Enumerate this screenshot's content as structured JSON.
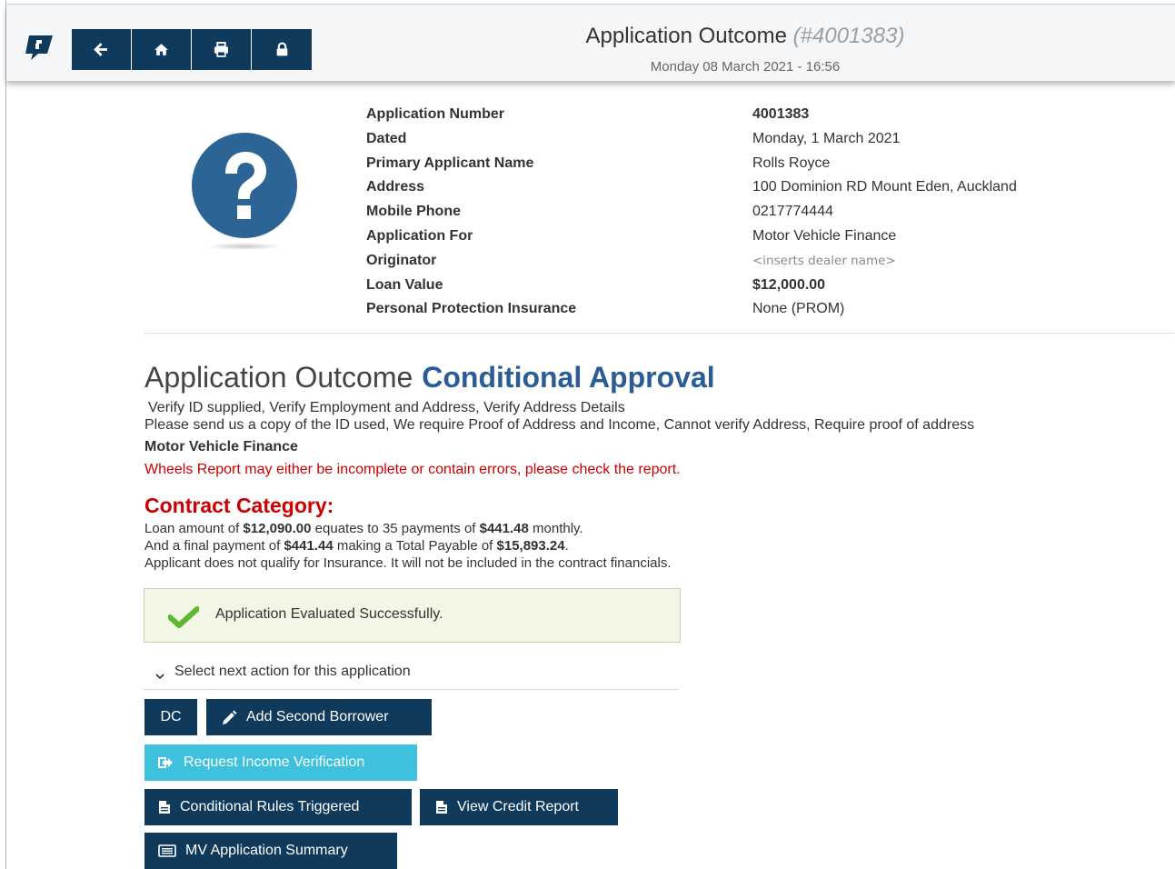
{
  "header": {
    "title": "Application Outcome",
    "app_number_display": "(#4001383)",
    "datetime": "Monday 08 March 2021 - 16:56",
    "nav_icons": [
      "back-arrow-icon",
      "home-icon",
      "print-icon",
      "lock-icon"
    ]
  },
  "applicant": {
    "labels": {
      "application_number": "Application Number",
      "dated": "Dated",
      "primary_applicant_name": "Primary Applicant Name",
      "address": "Address",
      "mobile_phone": "Mobile Phone",
      "application_for": "Application For",
      "originator": "Originator",
      "loan_value": "Loan Value",
      "ppi": "Personal Protection Insurance"
    },
    "values": {
      "application_number": "4001383",
      "dated": "Monday, 1 March 2021",
      "primary_applicant_name": "Rolls Royce",
      "address": "100 Dominion RD Mount Eden, Auckland",
      "mobile_phone": "0217774444",
      "application_for": "Motor Vehicle Finance",
      "originator": "<inserts dealer name>",
      "loan_value": "$12,000.00",
      "ppi": "None (PROM)"
    }
  },
  "outcome": {
    "title": "Application Outcome",
    "status": "Conditional Approval",
    "verify_requirements": "Verify ID supplied, Verify Employment and Address, Verify Address Details",
    "requests": "Please send us a copy of the ID used, We require Proof of Address and Income, Cannot verify Address, Require proof of address",
    "product": "Motor Vehicle Finance",
    "warning": "Wheels Report may either be incomplete or contain errors, please check the report."
  },
  "contract": {
    "title": "Contract Category:",
    "line1_pre": "Loan amount of ",
    "loan_amount": "$12,090.00",
    "line1_mid": " equates to 35 payments of ",
    "payment_amount": "$441.48",
    "line1_post": " monthly.",
    "line2_pre": "And a final payment of ",
    "final_payment": "$441.44",
    "line2_mid": " making a Total Payable of ",
    "total_payable": "$15,893.24",
    "line2_post": ".",
    "insurance_note": "Applicant does not qualify for Insurance. It will not be included in the contract financials."
  },
  "alert": {
    "message": "Application Evaluated Successfully.",
    "color": "#5cb82e"
  },
  "actions": {
    "section_label": "Select next action for this application",
    "dc": "DC",
    "add_second_borrower": "Add Second Borrower",
    "request_income_verification": "Request Income Verification",
    "conditional_rules_triggered": "Conditional Rules Triggered",
    "view_credit_report": "View Credit Report",
    "mv_application_summary": "MV Application Summary"
  },
  "colors": {
    "primary": "#0f3a5c",
    "accent": "#3fc0dc",
    "status_approval": "#2a5c96",
    "warning": "#cc0000"
  }
}
